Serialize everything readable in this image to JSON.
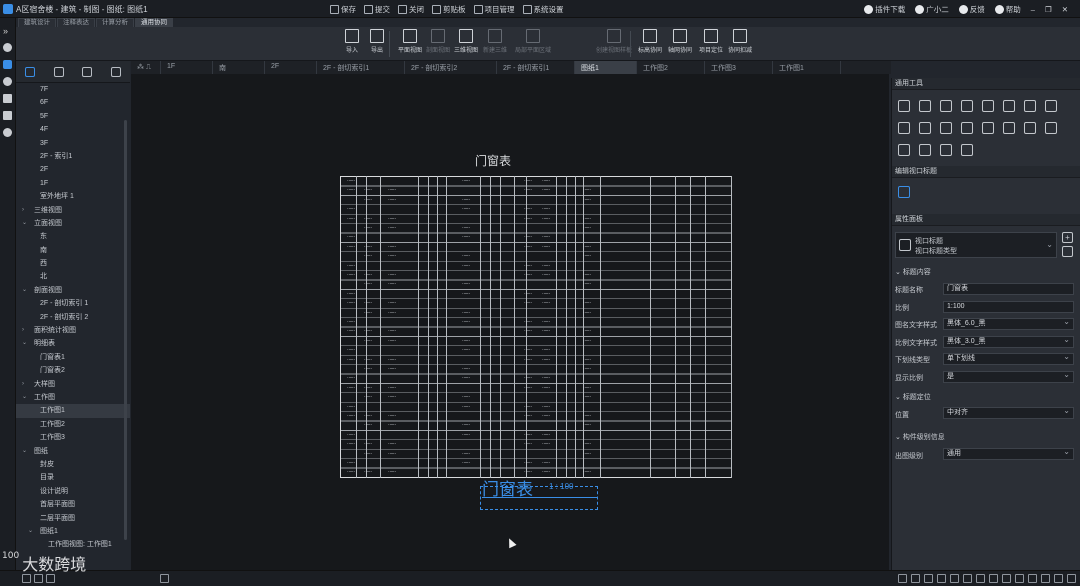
{
  "window": {
    "title": "A区宿舍楼 - 建筑 - 制图 - 图纸: 图纸1",
    "top_actions": [
      {
        "label": "保存"
      },
      {
        "label": "提交"
      },
      {
        "label": "关闭"
      },
      {
        "label": "剪贴板"
      },
      {
        "label": "项目管理"
      },
      {
        "label": "系统设置"
      }
    ],
    "top_right": [
      {
        "label": "插件下载"
      },
      {
        "label": "广小二"
      },
      {
        "label": "反馈"
      },
      {
        "label": "帮助"
      }
    ],
    "module_tabs": [
      "建筑设计",
      "注释表达",
      "计算分析",
      "通用协同"
    ]
  },
  "ribbon": [
    {
      "label": "导入",
      "enabled": true
    },
    {
      "label": "导出",
      "enabled": true
    },
    {
      "label": "平面视图",
      "enabled": true
    },
    {
      "label": "剖面视图",
      "enabled": false
    },
    {
      "label": "三维视图",
      "enabled": true
    },
    {
      "label": "新建三维",
      "enabled": false
    },
    {
      "label": "局部平面区域",
      "enabled": false
    },
    {
      "label": "创建视图样板",
      "enabled": false
    },
    {
      "label": "标高协同",
      "enabled": true
    },
    {
      "label": "轴网协同",
      "enabled": true
    },
    {
      "label": "项目定位",
      "enabled": true
    },
    {
      "label": "协同扣减",
      "enabled": true
    }
  ],
  "doc_tabs": [
    {
      "label": "1F",
      "active": false
    },
    {
      "label": "南",
      "active": false
    },
    {
      "label": "2F",
      "active": false
    },
    {
      "label": "2F - 剖切索引1",
      "active": false
    },
    {
      "label": "2F - 剖切索引2",
      "active": false
    },
    {
      "label": "2F - 剖切索引1",
      "active": false
    },
    {
      "label": "图纸1",
      "active": true
    },
    {
      "label": "工作图2",
      "active": false
    },
    {
      "label": "工作图3",
      "active": false
    },
    {
      "label": "工作图1",
      "active": false
    }
  ],
  "tree": [
    {
      "label": "7F",
      "indent": 2
    },
    {
      "label": "6F",
      "indent": 2
    },
    {
      "label": "5F",
      "indent": 2
    },
    {
      "label": "4F",
      "indent": 2
    },
    {
      "label": "3F",
      "indent": 2
    },
    {
      "label": "2F - 索引1",
      "indent": 2
    },
    {
      "label": "2F",
      "indent": 2
    },
    {
      "label": "1F",
      "indent": 2
    },
    {
      "label": "室外地坪 1",
      "indent": 2
    },
    {
      "label": "三维视图",
      "indent": 1,
      "expand": "›"
    },
    {
      "label": "立面视图",
      "indent": 1,
      "expand": "⌄"
    },
    {
      "label": "东",
      "indent": 2
    },
    {
      "label": "南",
      "indent": 2
    },
    {
      "label": "西",
      "indent": 2
    },
    {
      "label": "北",
      "indent": 2
    },
    {
      "label": "剖面视图",
      "indent": 1,
      "expand": "⌄"
    },
    {
      "label": "2F - 剖切索引 1",
      "indent": 2
    },
    {
      "label": "2F - 剖切索引 2",
      "indent": 2
    },
    {
      "label": "面积统计视图",
      "indent": 1,
      "expand": "›"
    },
    {
      "label": "明细表",
      "indent": 1,
      "expand": "⌄"
    },
    {
      "label": "门窗表1",
      "indent": 2
    },
    {
      "label": "门窗表2",
      "indent": 2
    },
    {
      "label": "大样图",
      "indent": 1,
      "expand": "›"
    },
    {
      "label": "工作图",
      "indent": 1,
      "expand": "⌄"
    },
    {
      "label": "工作图1",
      "indent": 2,
      "selected": true
    },
    {
      "label": "工作图2",
      "indent": 2
    },
    {
      "label": "工作图3",
      "indent": 2
    },
    {
      "label": "图纸",
      "indent": 1,
      "expand": "⌄"
    },
    {
      "label": "封皮",
      "indent": 2
    },
    {
      "label": "目录",
      "indent": 2
    },
    {
      "label": "设计说明",
      "indent": 2
    },
    {
      "label": "首层平面图",
      "indent": 2
    },
    {
      "label": "二层平面图",
      "indent": 2
    },
    {
      "label": "图纸1",
      "indent": 2,
      "expand": "⌄"
    },
    {
      "label": "工作图视图: 工作图1",
      "indent": 3
    }
  ],
  "drawing": {
    "sheet_title": "门窗表",
    "viewport_title": "门窗表",
    "viewport_scale": "1 : 100"
  },
  "panel": {
    "tools_header": "通用工具",
    "edit_header": "编辑视口标题",
    "props_header": "属性面板",
    "type_line1": "视口标题",
    "type_line2": "视口标题类型",
    "group_content": "标题内容",
    "group_position": "标题定位",
    "group_level": "构件级别信息",
    "props": [
      {
        "label": "标题名称",
        "value": "门窗表",
        "select": false
      },
      {
        "label": "比例",
        "value": "1:100",
        "select": false
      },
      {
        "label": "图名文字样式",
        "value": "黑体_6.0_黑",
        "select": true
      },
      {
        "label": "比例文字样式",
        "value": "黑体_3.0_黑",
        "select": true
      },
      {
        "label": "下划线类型",
        "value": "单下划线",
        "select": true
      },
      {
        "label": "显示比例",
        "value": "是",
        "select": true
      }
    ],
    "position_label": "位置",
    "position_value": "中对齐",
    "level_label": "出图级别",
    "level_value": "通用"
  },
  "watermark": "大数跨境",
  "colors": {
    "accent": "#3a8ee6",
    "canvas": "#16181b",
    "panel": "#2b2f36"
  }
}
